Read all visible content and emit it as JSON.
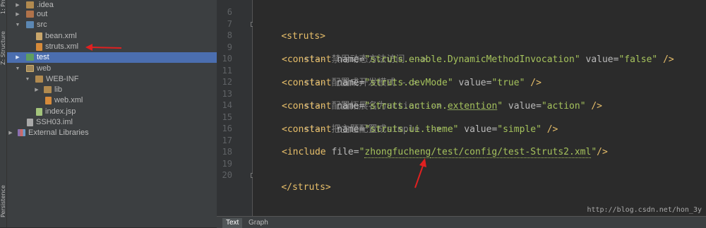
{
  "tool_strip": {
    "project_label": "1: Pro",
    "structure_label": "Z: Structure",
    "persistence_label": "Persistence"
  },
  "tree": [
    {
      "label": ".idea",
      "depth": 1,
      "arrow": "▶",
      "icon": "folder-icon",
      "selected": false
    },
    {
      "label": "out",
      "depth": 1,
      "arrow": "▶",
      "icon": "folder-icon",
      "selected": false
    },
    {
      "label": "src",
      "depth": 1,
      "arrow": "▼",
      "icon": "source-folder-icon",
      "selected": false
    },
    {
      "label": "bean.xml",
      "depth": 2,
      "arrow": "",
      "icon": "xml-file-icon",
      "selected": false
    },
    {
      "label": "struts.xml",
      "depth": 2,
      "arrow": "",
      "icon": "struts-xml-icon",
      "selected": false
    },
    {
      "label": "test",
      "depth": 1,
      "arrow": "▶",
      "icon": "test-folder-icon",
      "selected": true
    },
    {
      "label": "web",
      "depth": 1,
      "arrow": "▼",
      "icon": "web-folder-icon",
      "selected": false
    },
    {
      "label": "WEB-INF",
      "depth": 2,
      "arrow": "▼",
      "icon": "folder-icon",
      "selected": false
    },
    {
      "label": "lib",
      "depth": 3,
      "arrow": "▶",
      "icon": "folder-icon",
      "selected": false
    },
    {
      "label": "web.xml",
      "depth": 3,
      "arrow": "",
      "icon": "xml-file-icon",
      "selected": false
    },
    {
      "label": "index.jsp",
      "depth": 2,
      "arrow": "",
      "icon": "jsp-file-icon",
      "selected": false
    },
    {
      "label": "SSH03.iml",
      "depth": 1,
      "arrow": "",
      "icon": "iml-file-icon",
      "selected": false
    },
    {
      "label": "External Libraries",
      "depth": 0,
      "arrow": "▶",
      "icon": "external-libraries-icon",
      "selected": false
    }
  ],
  "editor": {
    "line_numbers": [
      "6",
      "7",
      "8",
      "9",
      "10",
      "11",
      "12",
      "13",
      "14",
      "15",
      "16",
      "17",
      "18",
      "19",
      "20"
    ],
    "lines": {
      "l7_open": "<struts>",
      "l9_comment": "<!-- 禁用动态方法访问 -->",
      "l10_tag": "<constant ",
      "l10_name_attr": "name=",
      "l10_name_val": "\"struts.enable.DynamicMethodInvocation\"",
      "l10_value_attr": " value=",
      "l10_value_val": "\"false\"",
      "l10_close": " />",
      "l11_comment": "<!-- 配置成开发模式 -->",
      "l12_tag": "<constant ",
      "l12_name_attr": "name=",
      "l12_name_val": "\"struts.devMode\"",
      "l12_value_attr": " value=",
      "l12_value_val": "\"true\"",
      "l12_close": " />",
      "l13_comment": "<!-- 配置拓展名为action -->",
      "l14_tag": "<constant ",
      "l14_name_attr": "name=",
      "l14_name_val_a": "\"struts.action.",
      "l14_name_val_b": "extention",
      "l14_name_val_c": "\"",
      "l14_value_attr": " value=",
      "l14_value_val": "\"action\"",
      "l14_close": " />",
      "l15_comment": "<!-- 把主题配置成simple -->",
      "l16_tag": "<constant ",
      "l16_name_attr": "name=",
      "l16_name_val": "\"struts.ui.theme\"",
      "l16_value_attr": " value=",
      "l16_value_val": "\"simple\"",
      "l16_close": " />",
      "l18_tag": "<include ",
      "l18_file_attr": "file=",
      "l18_q1": "\"",
      "l18_path_a": "zhongfucheng",
      "l18_path_b": "/test/config/test-Struts2.xml",
      "l18_q2": "\"",
      "l18_close": "/>",
      "l20_close": "</struts>"
    }
  },
  "watermark": "http://blog.csdn.net/hon_3y",
  "bottom_tabs": [
    {
      "label": "Text",
      "active": true
    },
    {
      "label": "Graph",
      "active": false
    }
  ],
  "colors": {
    "annotation_red": "#e02020",
    "selection": "#4b6eaf"
  }
}
